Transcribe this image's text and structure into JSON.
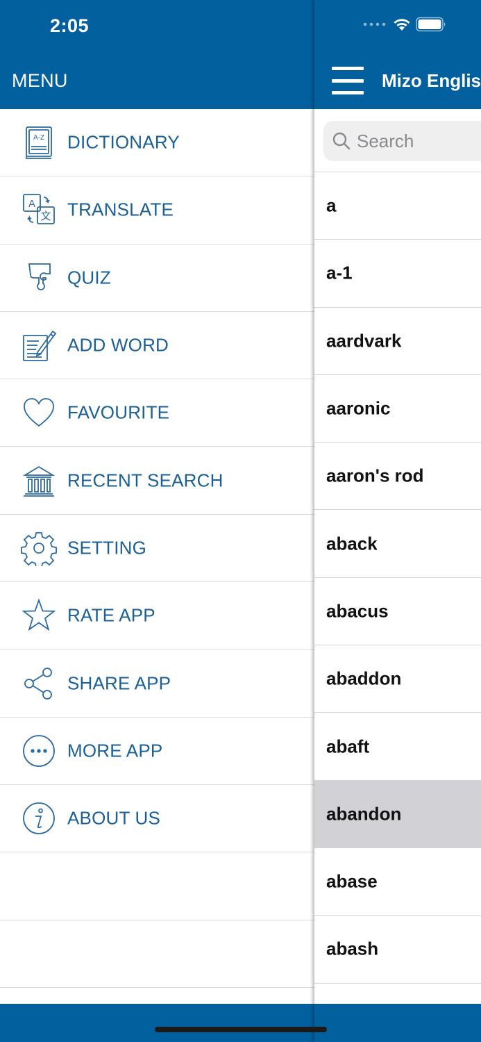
{
  "status_bar": {
    "time": "2:05"
  },
  "menu": {
    "title": "MENU",
    "items": [
      {
        "label": "DICTIONARY",
        "icon": "dictionary-book-icon"
      },
      {
        "label": "TRANSLATE",
        "icon": "translate-icon"
      },
      {
        "label": "QUIZ",
        "icon": "puzzle-icon"
      },
      {
        "label": "ADD WORD",
        "icon": "edit-note-icon"
      },
      {
        "label": "FAVOURITE",
        "icon": "heart-icon"
      },
      {
        "label": "RECENT SEARCH",
        "icon": "building-icon"
      },
      {
        "label": "SETTING",
        "icon": "gear-icon"
      },
      {
        "label": "RATE APP",
        "icon": "star-icon"
      },
      {
        "label": "SHARE APP",
        "icon": "share-icon"
      },
      {
        "label": "MORE APP",
        "icon": "more-dots-icon"
      },
      {
        "label": "ABOUT US",
        "icon": "info-icon"
      }
    ]
  },
  "main": {
    "title": "Mizo English",
    "search": {
      "placeholder": "Search",
      "value": ""
    },
    "words": [
      {
        "word": "a"
      },
      {
        "word": "a-1"
      },
      {
        "word": "aardvark"
      },
      {
        "word": "aaronic"
      },
      {
        "word": "aaron's rod"
      },
      {
        "word": "aback"
      },
      {
        "word": "abacus"
      },
      {
        "word": "abaddon"
      },
      {
        "word": "abaft"
      },
      {
        "word": "abandon",
        "selected": true
      },
      {
        "word": "abase"
      },
      {
        "word": "abash"
      }
    ]
  },
  "colors": {
    "primary": "#03609e",
    "menu_text": "#1a5f97",
    "icon_stroke": "#2c6aa0",
    "selected_row": "#d1d1d6",
    "divider": "#dcdcdc"
  }
}
